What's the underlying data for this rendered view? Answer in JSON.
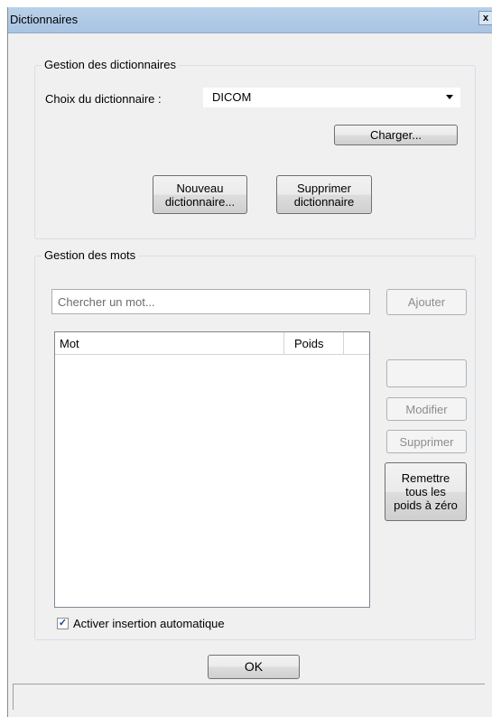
{
  "window": {
    "title": "Dictionnaires",
    "close_glyph": "x"
  },
  "dict_group": {
    "title": "Gestion des dictionnaires",
    "choice_label": "Choix du dictionnaire :",
    "selected_dictionary": "DICOM",
    "load_button": "Charger...",
    "new_button_line1": "Nouveau",
    "new_button_line2": "dictionnaire...",
    "delete_button_line1": "Supprimer",
    "delete_button_line2": "dictionnaire"
  },
  "words_group": {
    "title": "Gestion des mots",
    "search_placeholder": "Chercher un mot...",
    "add_button": "Ajouter",
    "columns": {
      "word": "Mot",
      "weight": "Poids"
    },
    "rows": [],
    "modify_button": "Modifier",
    "delete_button": "Supprimer",
    "reset_line1": "Remettre",
    "reset_line2": "tous les",
    "reset_line3": "poids à zéro",
    "auto_insert_label": "Activer insertion automatique",
    "auto_insert_checked": true
  },
  "ok_button": "OK"
}
